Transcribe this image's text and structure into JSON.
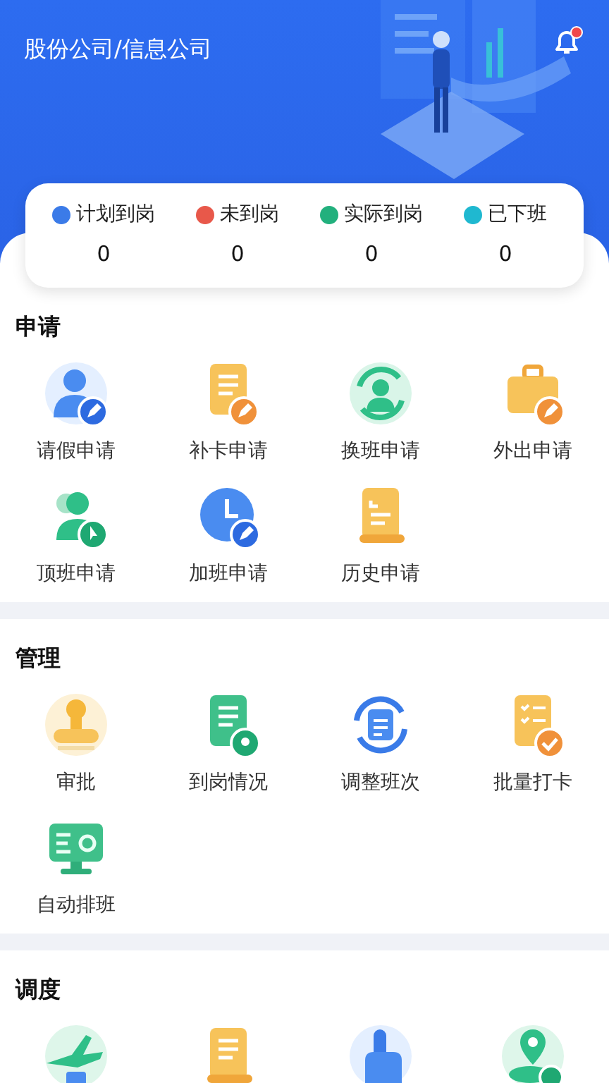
{
  "header": {
    "title": "股份公司/信息公司",
    "notification": {
      "unread": true
    }
  },
  "stats": [
    {
      "label": "计划到岗",
      "value": "0",
      "color": "#3b7be8"
    },
    {
      "label": "未到岗",
      "value": "0",
      "color": "#e8584a"
    },
    {
      "label": "实际到岗",
      "value": "0",
      "color": "#22b07d"
    },
    {
      "label": "已下班",
      "value": "0",
      "color": "#1fb8d0"
    }
  ],
  "sections": [
    {
      "title": "申请",
      "items": [
        {
          "kind": "shortcut",
          "label": "请假申请"
        },
        {
          "kind": "shortcut",
          "label": "补卡申请"
        },
        {
          "kind": "shortcut",
          "label": "换班申请"
        },
        {
          "kind": "shortcut",
          "label": "外出申请"
        },
        {
          "kind": "shortcut",
          "label": "顶班申请"
        },
        {
          "kind": "shortcut",
          "label": "加班申请"
        },
        {
          "kind": "shortcut",
          "label": "历史申请"
        }
      ]
    },
    {
      "title": "管理",
      "items": [
        {
          "kind": "shortcut",
          "label": "审批"
        },
        {
          "kind": "shortcut",
          "label": "到岗情况"
        },
        {
          "kind": "shortcut",
          "label": "调整班次"
        },
        {
          "kind": "shortcut",
          "label": "批量打卡"
        },
        {
          "kind": "shortcut",
          "label": "自动排班"
        }
      ]
    },
    {
      "title": "调度",
      "items": [
        {
          "kind": "icon-only"
        },
        {
          "kind": "icon-only"
        },
        {
          "kind": "icon-only"
        },
        {
          "kind": "icon-only"
        }
      ]
    }
  ]
}
